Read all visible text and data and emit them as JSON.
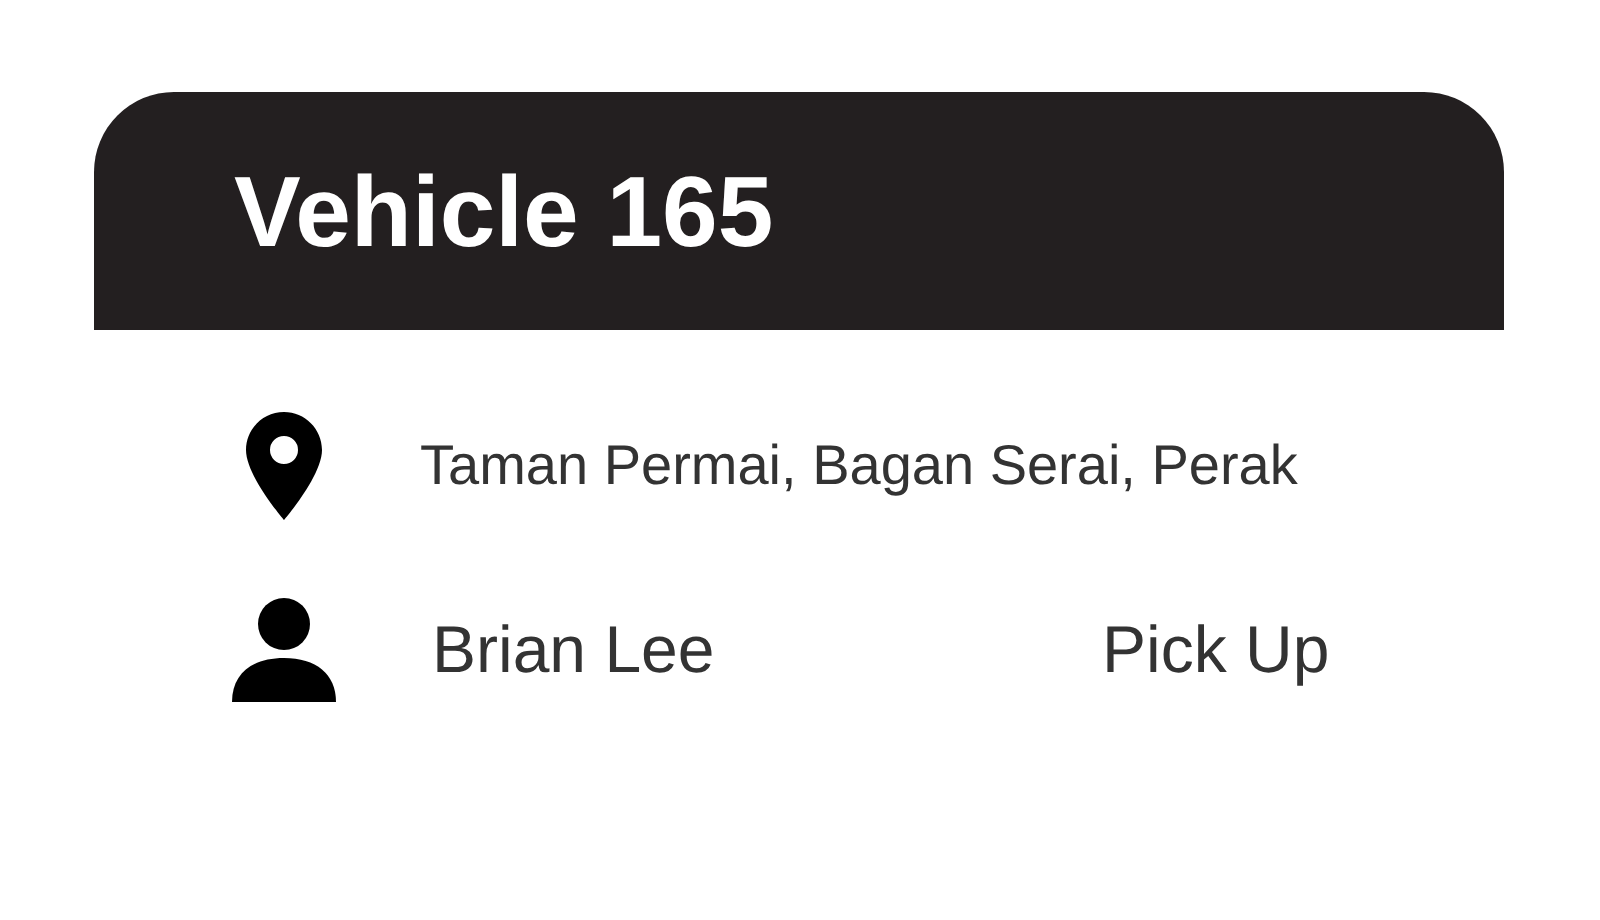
{
  "card": {
    "title": "Vehicle 165",
    "address": "Taman Permai, Bagan Serai, Perak",
    "person": "Brian Lee",
    "action": "Pick Up"
  }
}
